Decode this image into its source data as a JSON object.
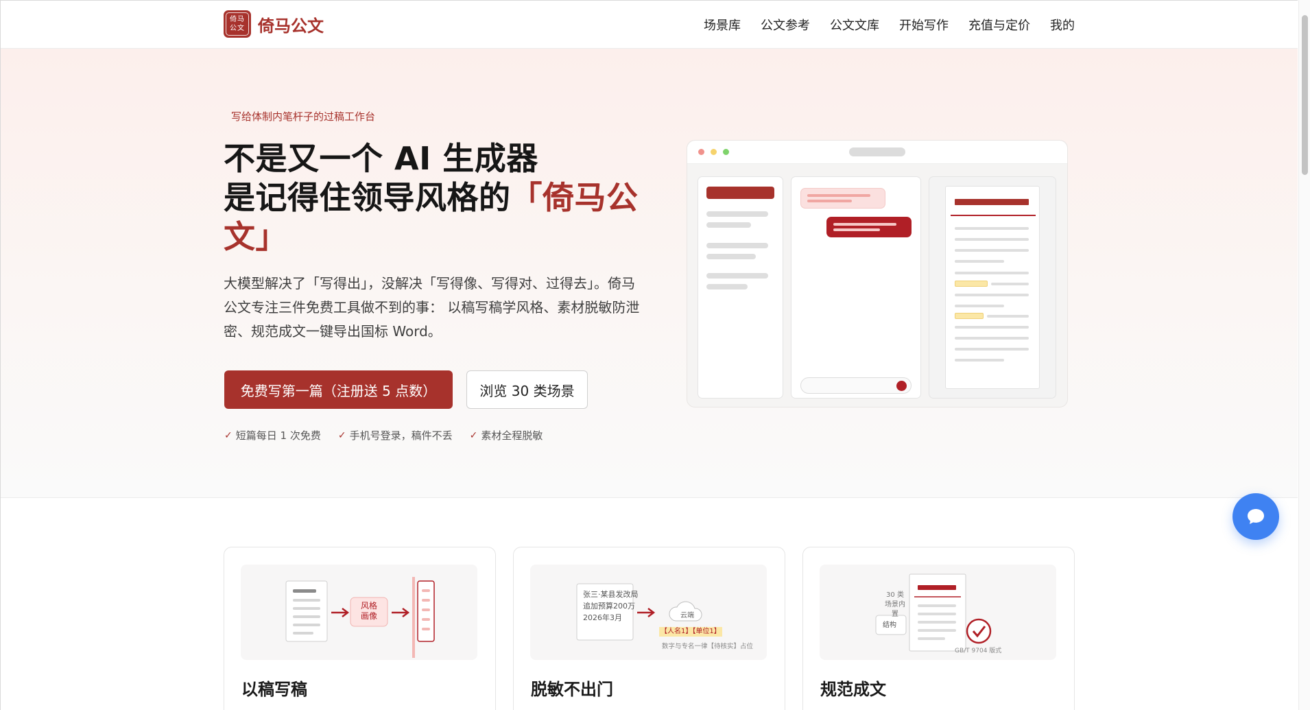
{
  "brand": {
    "logo_mark_top": "倚马",
    "logo_mark_bottom": "公文",
    "name": "倚马公文"
  },
  "nav": {
    "items": [
      "场景库",
      "公文参考",
      "公文文库",
      "开始写作",
      "充值与定价",
      "我的"
    ]
  },
  "hero": {
    "eyebrow": "写给体制内笔杆子的过稿工作台",
    "headline_line1": "不是又一个 AI 生成器",
    "headline_line2_prefix": "是记得住领导风格的",
    "headline_accent": "「倚马公文」",
    "lead": "大模型解决了「写得出」，没解决「写得像、写得对、过得去」。倚马公文专注三件免费工具做不到的事： 以稿写稿学风格、素材脱敏防泄密、规范成文一键导出国标 Word。",
    "primary_cta": "免费写第一篇（注册送 5 点数）",
    "secondary_cta": "浏览 30 类场景",
    "checks": [
      "短篇每日 1 次免费",
      "手机号登录，稿件不丢",
      "素材全程脱敏"
    ]
  },
  "features": [
    {
      "title": "以稿写稿",
      "illus_label_1": "风格",
      "illus_label_2": "画像"
    },
    {
      "title": "脱敏不出门",
      "illus_doc_lines": [
        "张三·某县发改局",
        "追加预算200万",
        "2026年3月"
      ],
      "illus_cloud": "云端",
      "illus_tags": "【人名1】【单位1】",
      "illus_caption": "数字与专名一律【待核实】占位"
    },
    {
      "title": "规范成文",
      "illus_count": "30 类",
      "illus_count_sub": "场景内置",
      "illus_struct": "结构",
      "illus_std": "GB/T 9704 版式"
    }
  ],
  "colors": {
    "brand": "#a7322c",
    "chat": "#3f82f2",
    "highlight": "#fbe7a6"
  },
  "icons": {
    "check": "check-icon",
    "chat": "chat-bubble-icon",
    "arrow": "arrow-right-icon"
  }
}
